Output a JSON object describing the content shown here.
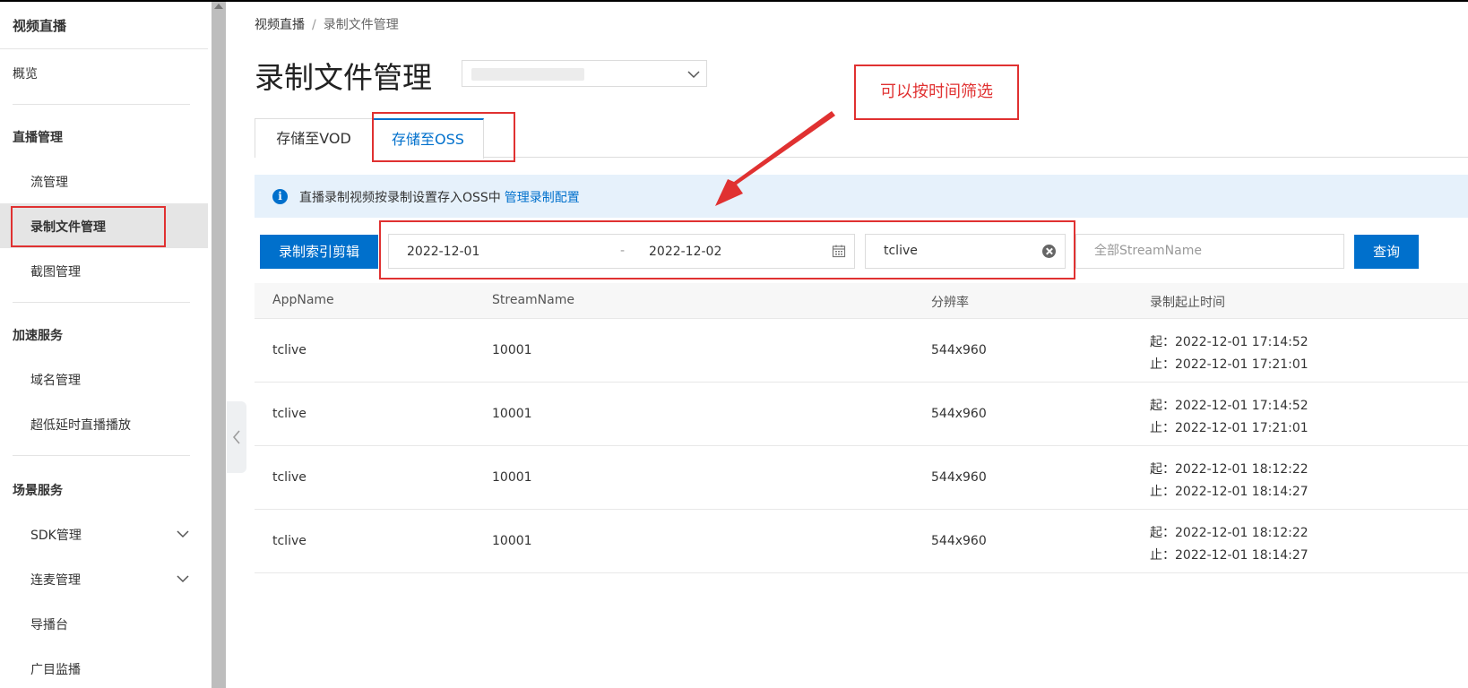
{
  "sidebar": {
    "title": "视频直播",
    "overview": "概览",
    "groups": {
      "live": "直播管理",
      "accel": "加速服务",
      "scene": "场景服务"
    },
    "items": {
      "stream": "流管理",
      "record": "录制文件管理",
      "snapshot": "截图管理",
      "domain": "域名管理",
      "low_latency": "超低延时直播播放",
      "sdk": "SDK管理",
      "mic": "连麦管理",
      "director": "导播台",
      "monitor": "广目监播"
    }
  },
  "breadcrumb": {
    "root": "视频直播",
    "sep": "/",
    "current": "录制文件管理"
  },
  "page": {
    "title": "录制文件管理"
  },
  "tabs": {
    "vod": "存储至VOD",
    "oss": "存储至OSS"
  },
  "info": {
    "text": "直播录制视频按录制设置存入OSS中",
    "link": "管理录制配置"
  },
  "toolbar": {
    "clip_button": "录制索引剪辑",
    "date_start": "2022-12-01",
    "date_sep": "-",
    "date_end": "2022-12-02",
    "app_value": "tclive",
    "stream_placeholder": "全部StreamName",
    "query_button": "查询"
  },
  "annotation": {
    "note": "可以按时间筛选"
  },
  "table": {
    "headers": [
      "AppName",
      "StreamName",
      "分辨率",
      "录制起止时间"
    ],
    "rows": [
      {
        "app": "tclive",
        "stream": "10001",
        "resolution": "544x960",
        "start": "起：2022-12-01 17:14:52",
        "end": "止：2022-12-01 17:21:01"
      },
      {
        "app": "tclive",
        "stream": "10001",
        "resolution": "544x960",
        "start": "起：2022-12-01 17:14:52",
        "end": "止：2022-12-01 17:21:01"
      },
      {
        "app": "tclive",
        "stream": "10001",
        "resolution": "544x960",
        "start": "起：2022-12-01 18:12:22",
        "end": "止：2022-12-01 18:14:27"
      },
      {
        "app": "tclive",
        "stream": "10001",
        "resolution": "544x960",
        "start": "起：2022-12-01 18:12:22",
        "end": "止：2022-12-01 18:14:27"
      }
    ]
  },
  "colors": {
    "primary": "#0070cc",
    "highlight": "#e03131",
    "info_bg": "#e6f1fb"
  }
}
